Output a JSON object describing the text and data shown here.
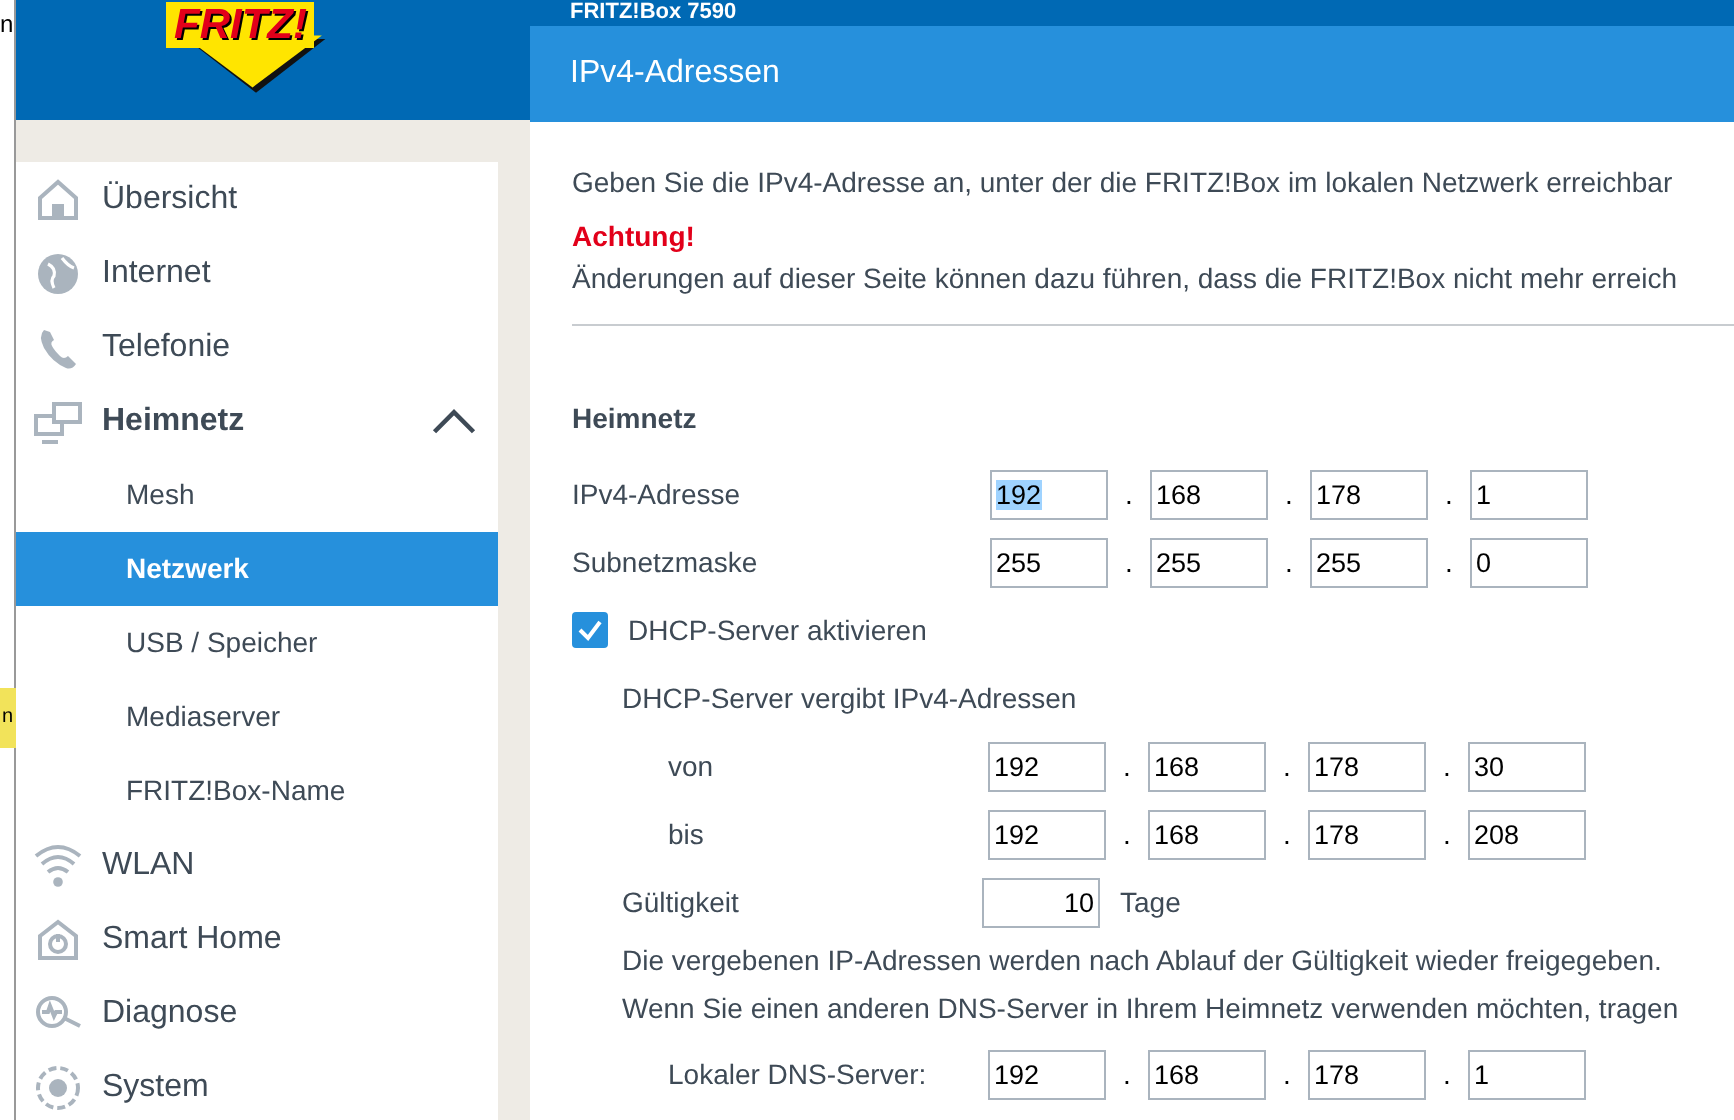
{
  "behind_window": {
    "top_text": "n",
    "tooltip_text": "n"
  },
  "header": {
    "logo": "FRITZ!",
    "title": "FRITZ!Box 7590"
  },
  "sidebar": {
    "items": [
      {
        "label": "Übersicht",
        "selected": false
      },
      {
        "label": "Internet",
        "selected": false
      },
      {
        "label": "Telefonie",
        "selected": false
      },
      {
        "label": "Heimnetz",
        "selected": false,
        "expanded": true,
        "children": [
          {
            "label": "Mesh",
            "selected": false
          },
          {
            "label": "Netzwerk",
            "selected": true
          },
          {
            "label": "USB / Speicher",
            "selected": false
          },
          {
            "label": "Mediaserver",
            "selected": false
          },
          {
            "label": "FRITZ!Box-Name",
            "selected": false
          }
        ]
      },
      {
        "label": "WLAN",
        "selected": false
      },
      {
        "label": "Smart Home",
        "selected": false
      },
      {
        "label": "Diagnose",
        "selected": false
      },
      {
        "label": "System",
        "selected": false
      }
    ]
  },
  "content": {
    "title": "IPv4-Adressen",
    "intro": "Geben Sie die IPv4-Adresse an, unter der die FRITZ!Box im lokalen Netzwerk erreichbar",
    "warning_label": "Achtung!",
    "warning_text": "Änderungen auf dieser Seite können dazu führen, dass die FRITZ!Box nicht mehr erreich",
    "section": "Heimnetz",
    "address_rows": [
      {
        "label": "IPv4-Adresse",
        "octets": [
          {
            "value": "192",
            "highlighted": true
          },
          {
            "separator": ".",
            "value": "168",
            "highlighted": false
          },
          {
            "separator": ".",
            "value": "178",
            "highlighted": false
          },
          {
            "separator": ".",
            "value": "1",
            "highlighted": false
          }
        ]
      },
      {
        "label": "Subnetzmaske",
        "octets": [
          {
            "value": "255",
            "highlighted": false
          },
          {
            "separator": ".",
            "value": "255",
            "highlighted": false
          },
          {
            "separator": ".",
            "value": "255",
            "highlighted": false
          },
          {
            "separator": ".",
            "value": "0",
            "highlighted": false
          }
        ]
      }
    ],
    "dhcp": {
      "label": "DHCP-Server aktivieren",
      "checked": true,
      "range_heading": "DHCP-Server vergibt IPv4-Adressen",
      "range_rows": [
        {
          "label": "von",
          "octets": [
            {
              "value": "192",
              "highlighted": false
            },
            {
              "separator": ".",
              "value": "168",
              "highlighted": false
            },
            {
              "separator": ".",
              "value": "178",
              "highlighted": false
            },
            {
              "separator": ".",
              "value": "30",
              "highlighted": false
            }
          ]
        },
        {
          "label": "bis",
          "octets": [
            {
              "value": "192",
              "highlighted": false
            },
            {
              "separator": ".",
              "value": "168",
              "highlighted": false
            },
            {
              "separator": ".",
              "value": "178",
              "highlighted": false
            },
            {
              "separator": ".",
              "value": "208",
              "highlighted": false
            }
          ]
        }
      ],
      "validity_label": "Gültigkeit",
      "validity_value": "10",
      "validity_unit": "Tage",
      "note_1": "Die vergebenen IP-Adressen werden nach Ablauf der Gültigkeit wieder freigegeben.",
      "note_2": "Wenn Sie einen anderen DNS-Server in Ihrem Heimnetz verwenden möchten, tragen",
      "dns_row": {
        "label": "Lokaler DNS-Server:",
        "octets": [
          {
            "value": "192",
            "highlighted": false
          },
          {
            "separator": ".",
            "value": "168",
            "highlighted": false
          },
          {
            "separator": ".",
            "value": "178",
            "highlighted": false
          },
          {
            "separator": ".",
            "value": "1",
            "highlighted": false
          }
        ]
      }
    }
  }
}
